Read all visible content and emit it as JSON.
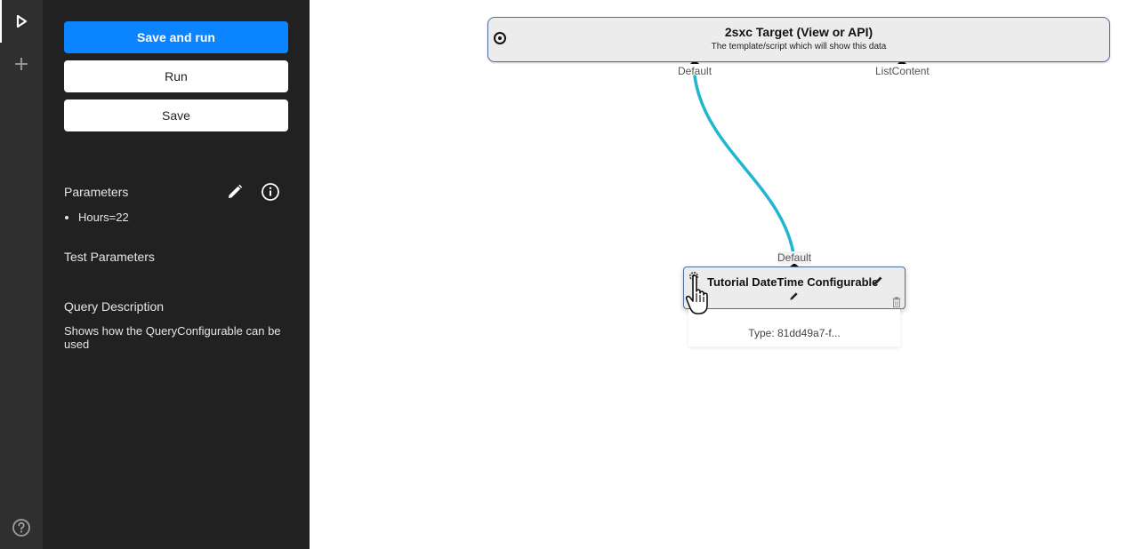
{
  "sidebar": {
    "run_icon": "play-icon",
    "add_icon": "plus-icon",
    "help_icon": "help-circle-icon"
  },
  "panel": {
    "save_and_run_label": "Save and run",
    "run_label": "Run",
    "save_label": "Save",
    "parameters": {
      "title": "Parameters",
      "items": [
        "Hours=22"
      ],
      "edit_icon": "pencil-icon",
      "info_icon": "info-icon"
    },
    "test_parameters_title": "Test Parameters",
    "query_description": {
      "title": "Query Description",
      "text": "Shows how the QueryConfigurable can be used"
    }
  },
  "canvas": {
    "target_node": {
      "title": "2sxc Target (View or API)",
      "description": "The template/script which will show this data",
      "ports": [
        "Default",
        "ListContent"
      ],
      "icon": "target-icon"
    },
    "source_node": {
      "title": "Tutorial DateTime Configurable",
      "out_port": "Default",
      "type_text": "Type: 81dd49a7-f...",
      "icons": [
        "gear-icon",
        "pencil-icon",
        "trash-icon"
      ]
    },
    "wire_color": "#1fb6d0",
    "accent": "#0a84ff"
  }
}
